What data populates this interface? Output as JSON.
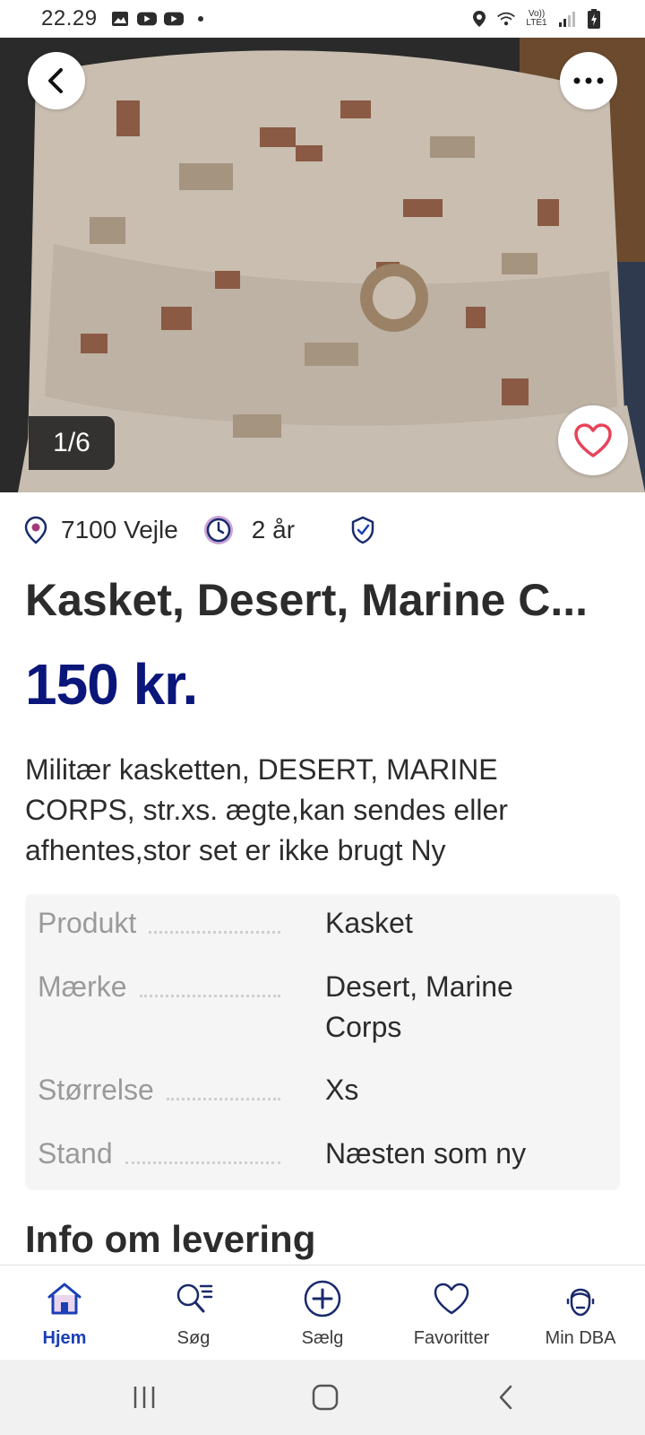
{
  "status_bar": {
    "time": "22.29",
    "network_label": "Vo)) LTE1",
    "icons_left": [
      "image-icon",
      "youtube-icon",
      "youtube-icon",
      "dot-icon"
    ],
    "icons_right": [
      "location-icon",
      "wifi-icon",
      "signal-icon",
      "battery-icon"
    ]
  },
  "listing": {
    "image_counter": "1/6",
    "location": "7100 Vejle",
    "age": "2 år",
    "title": "Kasket, Desert, Marine C...",
    "price": "150 kr.",
    "description": "Militær kasketten, DESERT, MARINE CORPS, str.xs. ægte,kan sendes eller afhentes,stor set er ikke brugt Ny"
  },
  "specs": [
    {
      "label": "Produkt",
      "value": "Kasket"
    },
    {
      "label": "Mærke",
      "value": "Desert, Marine Corps"
    },
    {
      "label": "Størrelse",
      "value": "Xs"
    },
    {
      "label": "Stand",
      "value": "Næsten som ny"
    }
  ],
  "delivery": {
    "heading": "Info om levering"
  },
  "nav": [
    {
      "label": "Hjem",
      "icon": "home-icon",
      "active": true
    },
    {
      "label": "Søg",
      "icon": "search-icon",
      "active": false
    },
    {
      "label": "Sælg",
      "icon": "plus-circle-icon",
      "active": false
    },
    {
      "label": "Favoritter",
      "icon": "heart-icon",
      "active": false
    },
    {
      "label": "Min DBA",
      "icon": "profile-icon",
      "active": false
    }
  ],
  "colors": {
    "price": "#0a167a",
    "nav_active": "#1b3fb5",
    "icon_navy": "#1a2a6c",
    "favorite_heart": "#e8435a",
    "location_pin": "#a33a7c"
  }
}
